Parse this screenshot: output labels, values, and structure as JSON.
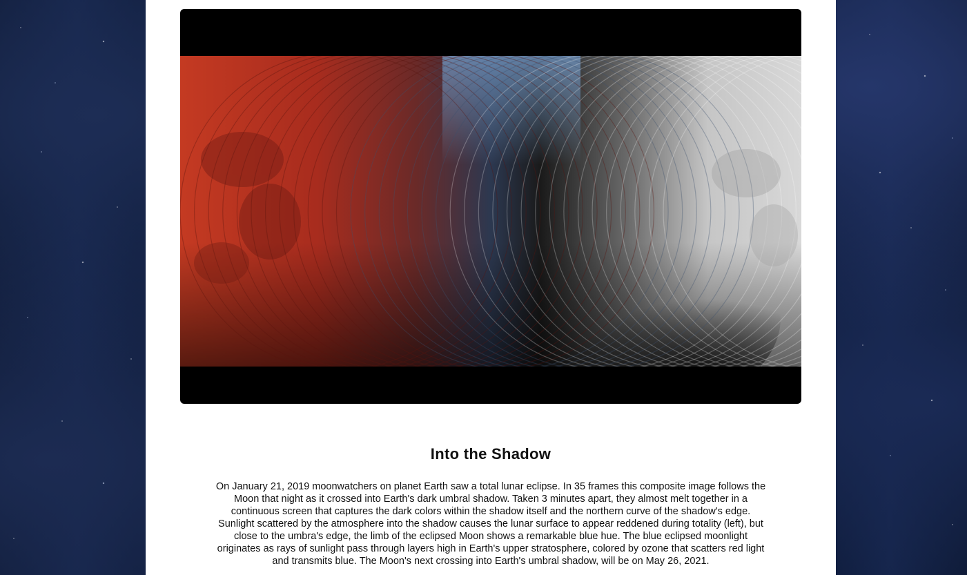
{
  "apod": {
    "title": "Into the Shadow",
    "description": "On January 21, 2019 moonwatchers on planet Earth saw a total lunar eclipse. In 35 frames this composite image follows the Moon that night as it crossed into Earth's dark umbral shadow. Taken 3 minutes apart, they almost melt together in a continuous screen that captures the dark colors within the shadow itself and the northern curve of the shadow's edge. Sunlight scattered by the atmosphere into the shadow causes the lunar surface to appear reddened during totality (left), but close to the umbra's edge, the limb of the eclipsed Moon shows a remarkable blue hue. The blue eclipsed moonlight originates as rays of sunlight pass through layers high in Earth's upper stratosphere, colored by ozone that scatters red light and transmits blue. The Moon's next crossing into Earth's umbral shadow, will be on May 26, 2021.",
    "image": {
      "alt": "Composite of 35 frames of the total lunar eclipse of January 21, 2019",
      "frame_count": 35
    }
  },
  "colors": {
    "page_background": "#0b1630",
    "panel_background": "#ffffff",
    "eclipse_red": "#b8321f",
    "eclipse_blue": "#5b7fa8",
    "moon_grey": "#c8c8c8",
    "text": "#111111"
  }
}
